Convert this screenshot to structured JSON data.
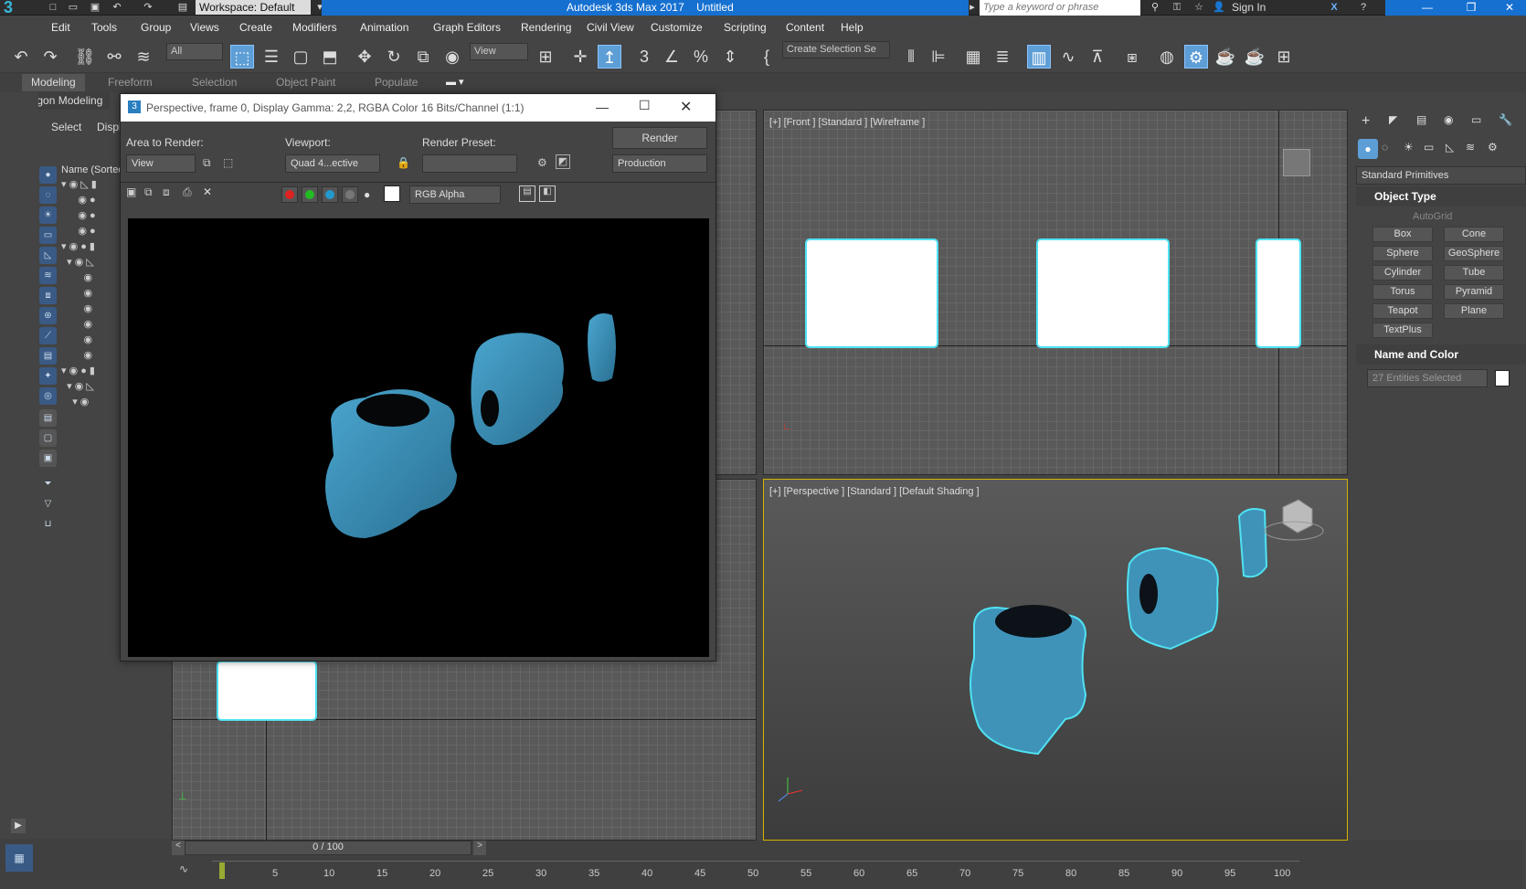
{
  "app": {
    "title": "Autodesk 3ds Max 2017",
    "document": "Untitled",
    "workspace": "Workspace: Default",
    "search_placeholder": "Type a keyword or phrase",
    "sign_in": "Sign In"
  },
  "menus": [
    "Edit",
    "Tools",
    "Group",
    "Views",
    "Create",
    "Modifiers",
    "Animation",
    "Graph Editors",
    "Rendering",
    "Civil View",
    "Customize",
    "Scripting",
    "Content",
    "Help"
  ],
  "toolbar": {
    "filter": "All",
    "ref_coord": "View",
    "selection_set": "Create Selection Se"
  },
  "ribbon": {
    "tabs": [
      "Modeling",
      "Freeform",
      "Selection",
      "Object Paint",
      "Populate"
    ],
    "sub": "Polygon Modeling"
  },
  "scene_explorer": {
    "tabs": [
      "Select",
      "Displ"
    ],
    "column": "Name (Sorted"
  },
  "viewports": {
    "front": "[+] [Front ] [Standard ] [Wireframe ]",
    "perspective": "[+] [Perspective ] [Standard ] [Default Shading ]"
  },
  "render_window": {
    "title": "Perspective, frame 0, Display Gamma: 2,2, RGBA Color 16 Bits/Channel (1:1)",
    "area_label": "Area to Render:",
    "area_value": "View",
    "viewport_label": "Viewport:",
    "viewport_value": "Quad 4...ective",
    "preset_label": "Render Preset:",
    "preset_value": "",
    "render_button": "Render",
    "production": "Production",
    "channel": "RGB Alpha"
  },
  "command_panel": {
    "category": "Standard Primitives",
    "object_type": "Object Type",
    "autogrid": "AutoGrid",
    "buttons": [
      "Box",
      "Cone",
      "Sphere",
      "GeoSphere",
      "Cylinder",
      "Tube",
      "Torus",
      "Pyramid",
      "Teapot",
      "Plane",
      "TextPlus"
    ],
    "name_color": "Name and Color",
    "selection": "27 Entities Selected"
  },
  "timeline": {
    "frame": "0 / 100",
    "ticks": [
      "5",
      "10",
      "15",
      "20",
      "25",
      "30",
      "35",
      "40",
      "45",
      "50",
      "55",
      "60",
      "65",
      "70",
      "75",
      "80",
      "85",
      "90",
      "95",
      "100"
    ]
  },
  "colors": {
    "accent": "#1670d0",
    "selection": "#4fe2f2",
    "product": "#3f93b9",
    "active_tool": "#5e9ed6"
  }
}
